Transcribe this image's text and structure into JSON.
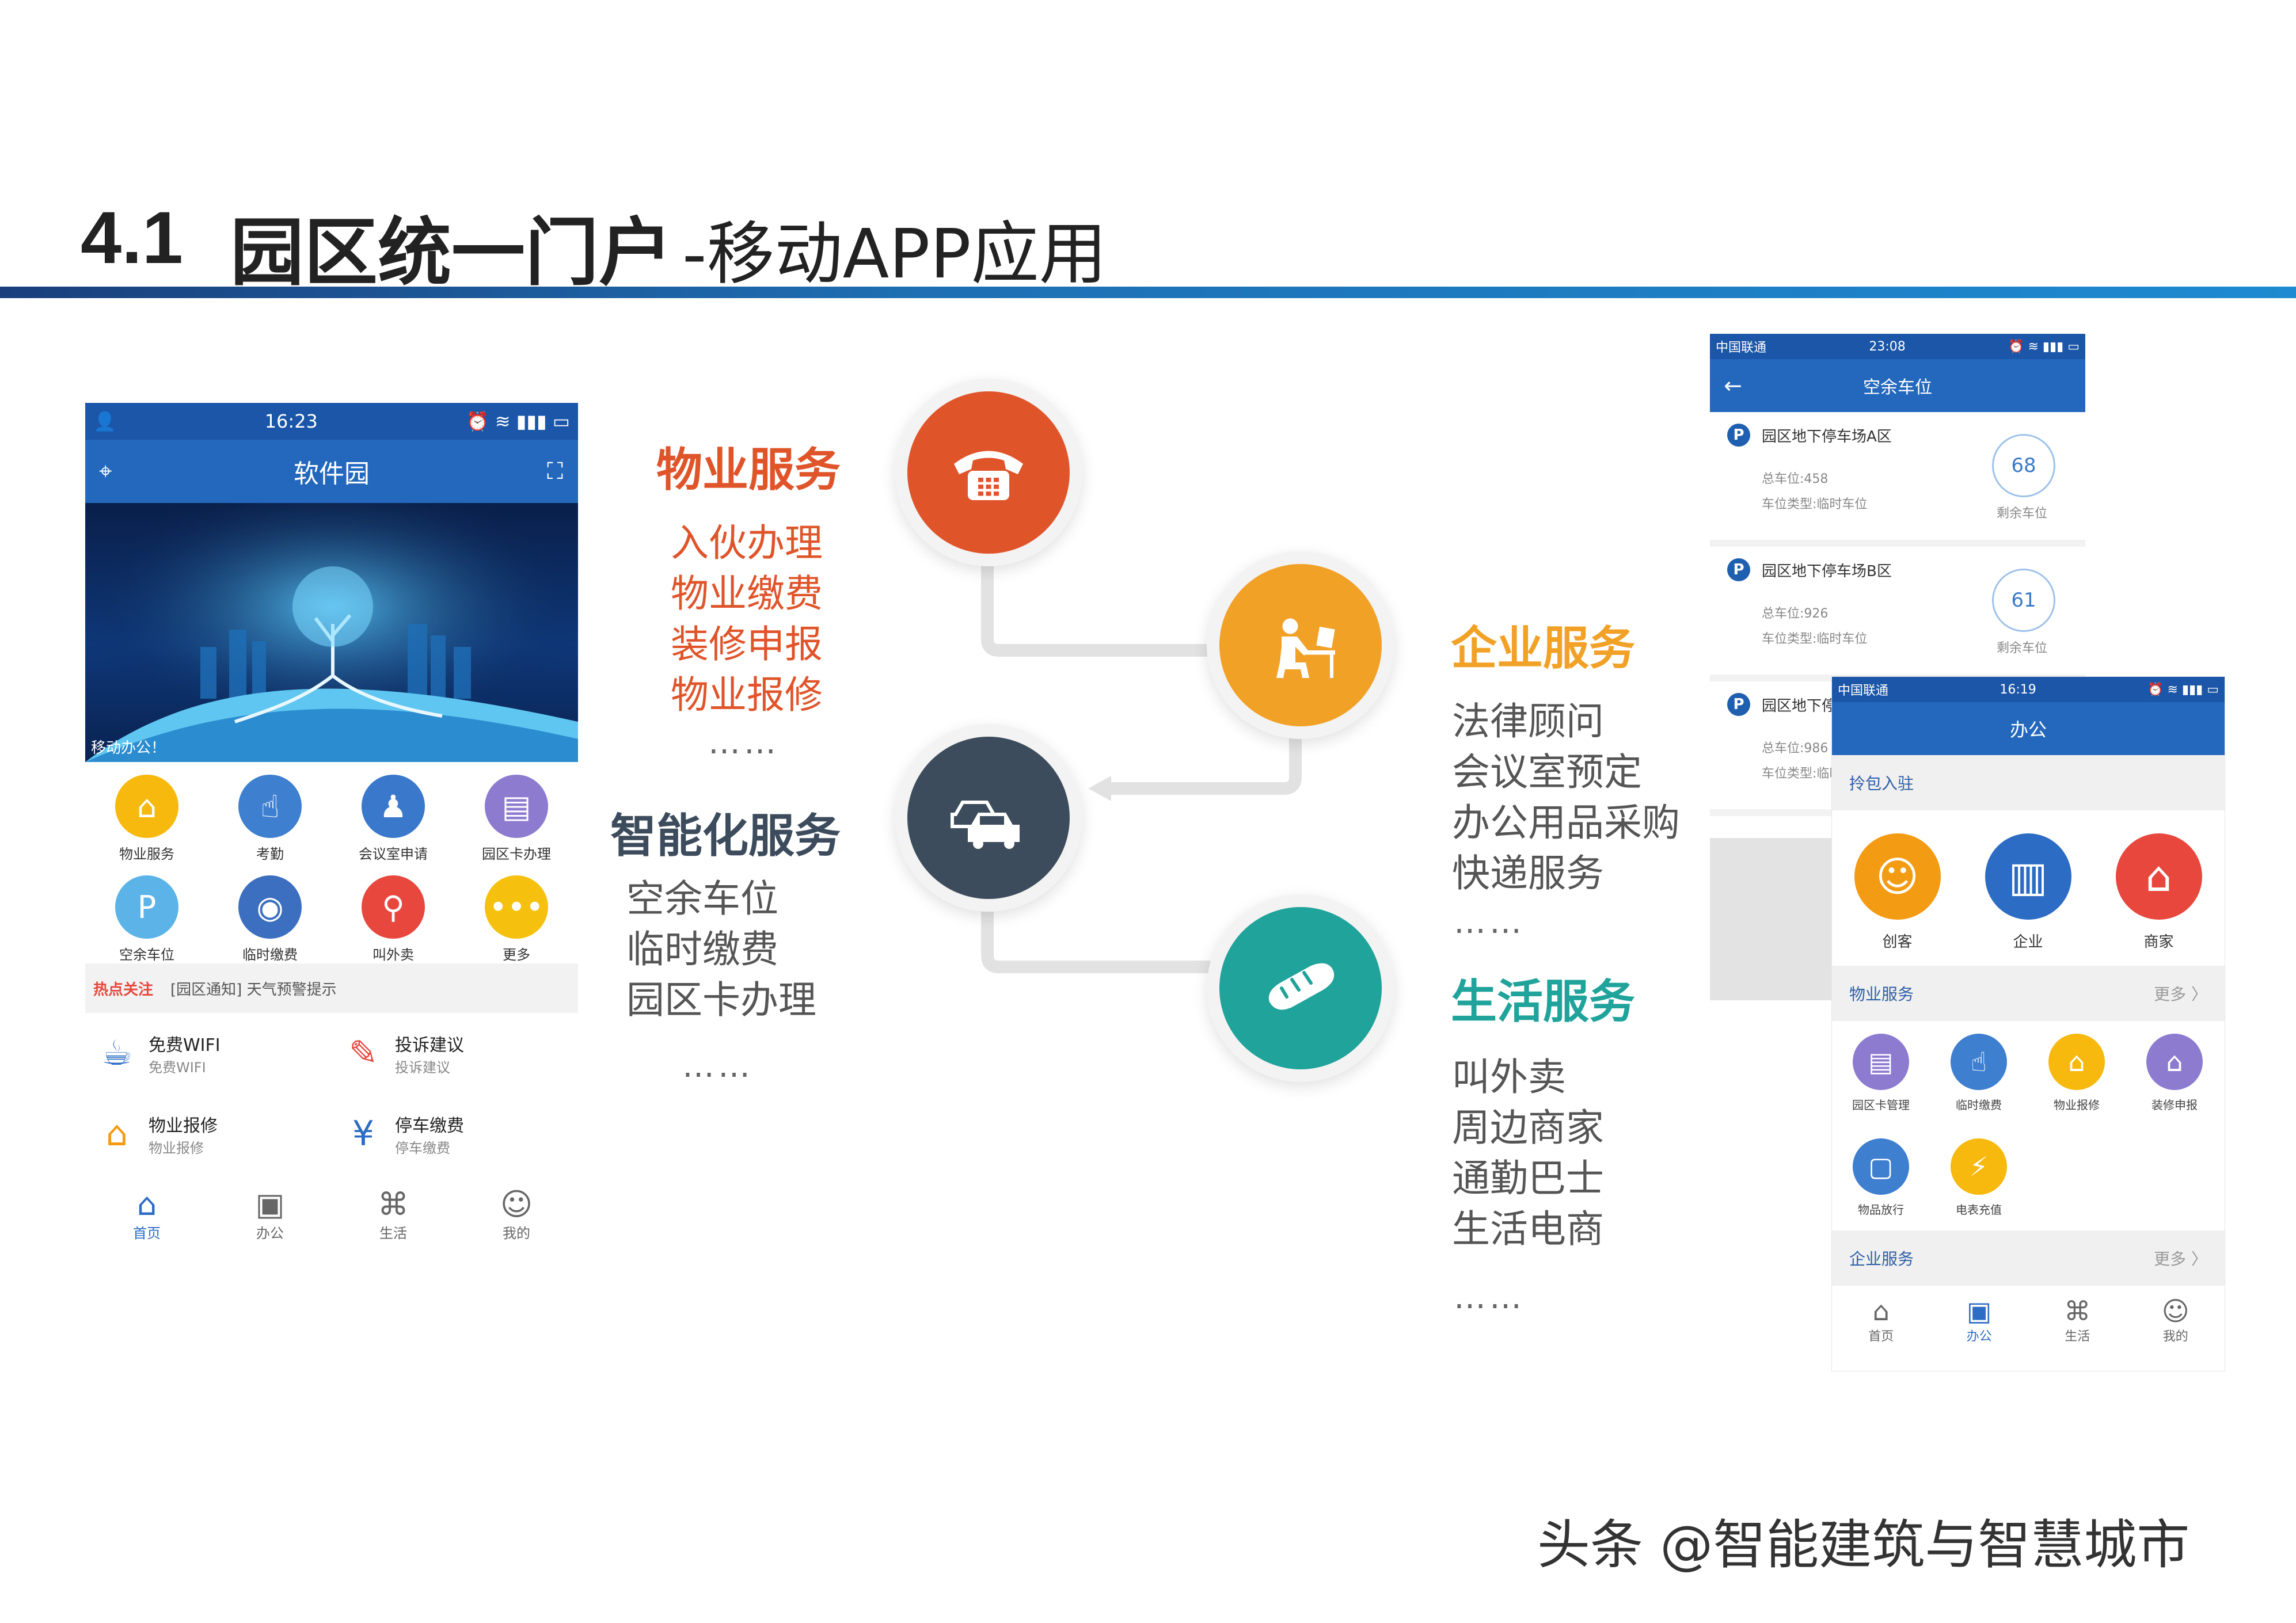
{
  "title": {
    "num": "4.1",
    "main": "园区统一门户",
    "sub": "-移动APP应用"
  },
  "phone1": {
    "status_time": "16:23",
    "nav_title": "软件园",
    "banner_caption": "移动办公！",
    "grid": [
      {
        "label": "物业服务",
        "icon": "house-icon",
        "color": "#f7b90e",
        "glyph": "⌂"
      },
      {
        "label": "考勤",
        "icon": "touch-icon",
        "color": "#3e7fd0",
        "glyph": "☝"
      },
      {
        "label": "会议室申请",
        "icon": "meeting-icon",
        "color": "#3a78cc",
        "glyph": "♟"
      },
      {
        "label": "园区卡办理",
        "icon": "card-icon",
        "color": "#8d7bd0",
        "glyph": "▤"
      },
      {
        "label": "空余车位",
        "icon": "parking-icon",
        "color": "#5bb3e8",
        "glyph": "P"
      },
      {
        "label": "临时缴费",
        "icon": "mouse-icon",
        "color": "#3c6fbf",
        "glyph": "◉"
      },
      {
        "label": "叫外卖",
        "icon": "scooter-icon",
        "color": "#e8473e",
        "glyph": "⚲"
      },
      {
        "label": "更多",
        "icon": "more-icon",
        "color": "#f5c10e",
        "glyph": "•••"
      }
    ],
    "news_label": "热点关注",
    "news_text": "[园区通知] 天气预警提示",
    "list": [
      {
        "title": "免费WIFI",
        "sub": "免费WIFI",
        "icon": "coffee-icon",
        "glyph": "☕",
        "color": "#2d6cc4"
      },
      {
        "title": "投诉建议",
        "sub": "投诉建议",
        "icon": "pencil-icon",
        "glyph": "✎",
        "color": "#e8473e"
      },
      {
        "title": "物业报修",
        "sub": "物业报修",
        "icon": "house-icon",
        "glyph": "⌂",
        "color": "#f39b12"
      },
      {
        "title": "停车缴费",
        "sub": "停车缴费",
        "icon": "phone-pay-icon",
        "glyph": "¥",
        "color": "#2d6cc4"
      }
    ],
    "tabs": [
      {
        "label": "首页",
        "glyph": "⌂"
      },
      {
        "label": "办公",
        "glyph": "▣"
      },
      {
        "label": "生活",
        "glyph": "⌘"
      },
      {
        "label": "我的",
        "glyph": "☺"
      }
    ]
  },
  "services": {
    "property": {
      "title": "物业服务",
      "items": [
        "入伙办理",
        "物业缴费",
        "装修申报",
        "物业报修"
      ],
      "more": "……",
      "color": "#e0542a"
    },
    "smart": {
      "title": "智能化服务",
      "items": [
        "空余车位",
        "临时缴费",
        "园区卡办理"
      ],
      "more": "……",
      "color": "#3d4c5c"
    },
    "enterprise": {
      "title": "企业服务",
      "items": [
        "法律顾问",
        "会议室预定",
        "办公用品采购",
        "快递服务"
      ],
      "more": "……",
      "color": "#f2a127"
    },
    "life": {
      "title": "生活服务",
      "items": [
        "叫外卖",
        "周边商家",
        "通勤巴士",
        "生活电商"
      ],
      "more": "……",
      "color": "#1fa39a"
    }
  },
  "phone2": {
    "carrier": "中国联通",
    "status_time": "23:08",
    "nav_title": "空余车位",
    "cards": [
      {
        "name": "园区地下停车场A区",
        "total": "总车位:458",
        "type": "车位类型:临时车位",
        "remaining": "68",
        "remaining_label": "剩余车位"
      },
      {
        "name": "园区地下停车场B区",
        "total": "总车位:926",
        "type": "车位类型:临时车位",
        "remaining": "61",
        "remaining_label": "剩余车位"
      },
      {
        "name": "园区地下停车场C区",
        "total": "总车位:986",
        "type": "车位类型:临时车位"
      }
    ]
  },
  "phone3": {
    "carrier": "中国联通",
    "status_time": "16:19",
    "nav_title": "办公",
    "top_section": "拎包入驻",
    "big_icons": [
      {
        "label": "创客",
        "icon": "person-icon",
        "glyph": "☺",
        "color": "#f39b12"
      },
      {
        "label": "企业",
        "icon": "building-icon",
        "glyph": "▥",
        "color": "#2d6cc4"
      },
      {
        "label": "商家",
        "icon": "shop-icon",
        "glyph": "⌂",
        "color": "#e8473e"
      }
    ],
    "property_section": "物业服务",
    "property_icons": [
      {
        "label": "园区卡管理",
        "icon": "card-icon",
        "glyph": "▤",
        "color": "#8d7bd0"
      },
      {
        "label": "临时缴费",
        "icon": "touch-icon",
        "glyph": "☝",
        "color": "#3e7fd0"
      },
      {
        "label": "物业报修",
        "icon": "house-icon",
        "glyph": "⌂",
        "color": "#f7b90e"
      },
      {
        "label": "装修申报",
        "icon": "home-check-icon",
        "glyph": "⌂",
        "color": "#8d7bd0"
      },
      {
        "label": "物品放行",
        "icon": "box-icon",
        "glyph": "▢",
        "color": "#3e7fd0"
      },
      {
        "label": "电表充值",
        "icon": "bolt-icon",
        "glyph": "⚡",
        "color": "#f7b90e"
      }
    ],
    "enterprise_section": "企业服务",
    "more_label": "更多 〉",
    "tabs": [
      {
        "label": "首页",
        "glyph": "⌂"
      },
      {
        "label": "办公",
        "glyph": "▣"
      },
      {
        "label": "生活",
        "glyph": "⌘"
      },
      {
        "label": "我的",
        "glyph": "☺"
      }
    ]
  },
  "watermark": "头条 @智能建筑与智慧城市"
}
